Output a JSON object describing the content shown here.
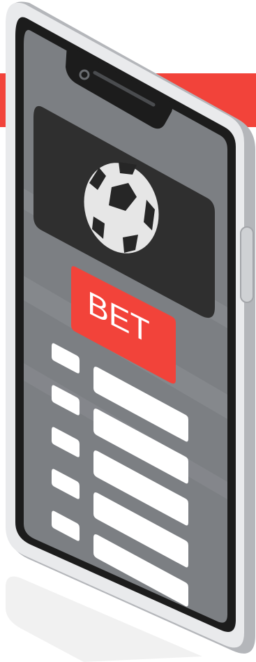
{
  "colors": {
    "background": "#ffffff",
    "accent_red": "#f2433a",
    "phone_body": "#e9eaec",
    "phone_edge": "#b4b6ba",
    "phone_bezel": "#1c1c1c",
    "screen": "#7c7f83",
    "screen_stripe": "#8d9094",
    "card": "#2f2f2f",
    "ball_white": "#e6e6e6",
    "ball_patch": "#262626",
    "list_bar": "#ffffff",
    "shadow": "#f0f0f0"
  },
  "icons": {
    "camera": "camera-icon",
    "speaker": "speaker-slot-icon",
    "side_button": "side-button",
    "ball": "soccer-ball-icon"
  },
  "bet_button": {
    "label": "BET"
  },
  "bet_list": {
    "rows": 5
  }
}
